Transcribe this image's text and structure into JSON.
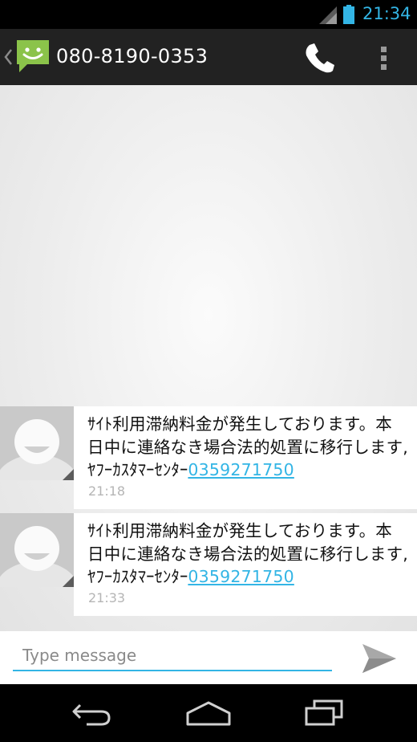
{
  "status_bar": {
    "time": "21:34"
  },
  "action_bar": {
    "title": "080-8190-0353"
  },
  "messages": [
    {
      "text": "ｻｲﾄ利用滞納料金が発生しております。本日中に連絡なき場合法的処置に移行します,ﾔﾌｰｶｽﾀﾏｰｾﾝﾀｰ",
      "link": "0359271750",
      "time": "21:18"
    },
    {
      "text": "ｻｲﾄ利用滞納料金が発生しております。本日中に連絡なき場合法的処置に移行します,ﾔﾌｰｶｽﾀﾏｰｾﾝﾀｰ",
      "link": "0359271750",
      "time": "21:33"
    }
  ],
  "compose": {
    "placeholder": "Type message"
  },
  "colors": {
    "accent": "#33b5e5",
    "action_bar": "#222222",
    "app_icon": "#8bc34a"
  },
  "icons": [
    "signal-icon",
    "battery-icon",
    "back-caret-icon",
    "messaging-app-icon",
    "phone-icon",
    "overflow-menu-icon",
    "avatar-silhouette-icon",
    "send-icon",
    "nav-back-icon",
    "nav-home-icon",
    "nav-recents-icon"
  ]
}
